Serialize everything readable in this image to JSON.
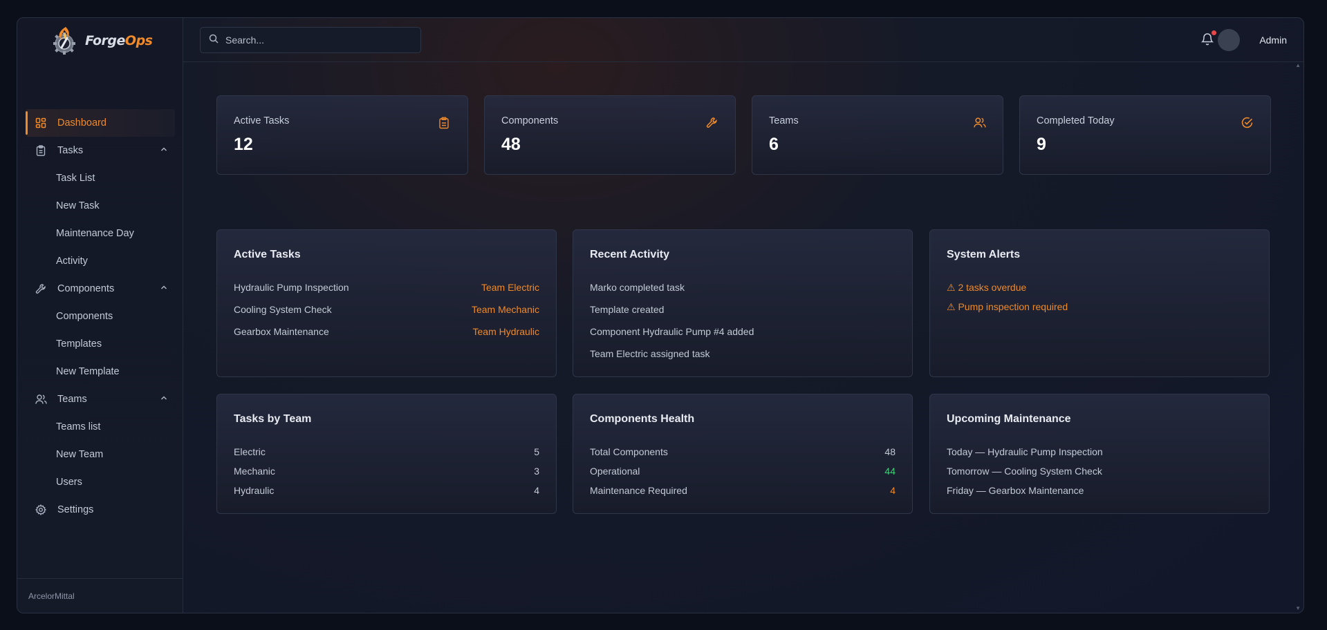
{
  "app": {
    "logo_prefix": "Forge",
    "logo_suffix": "Ops",
    "company": "ArcelorMittal"
  },
  "colors": {
    "accent": "#f08a2a",
    "success": "#44d07a",
    "alert_dot": "#e8474a"
  },
  "search": {
    "placeholder": "Search...",
    "value": ""
  },
  "user": {
    "name": "Admin"
  },
  "sidebar": {
    "dashboard": {
      "label": "Dashboard",
      "icon": "dashboard-icon"
    },
    "tasks": {
      "label": "Tasks",
      "icon": "clipboard-icon",
      "sub": [
        "Task List",
        "New Task",
        "Maintenance Day",
        "Activity"
      ]
    },
    "components": {
      "label": "Components",
      "icon": "wrench-icon",
      "sub": [
        "Components",
        "Templates",
        "New Template"
      ]
    },
    "teams": {
      "label": "Teams",
      "icon": "users-icon",
      "sub": [
        "Teams list",
        "New Team",
        "Users"
      ]
    },
    "settings": {
      "label": "Settings",
      "icon": "gear-icon"
    }
  },
  "stats": [
    {
      "label": "Active Tasks",
      "value": "12",
      "icon": "clipboard-icon"
    },
    {
      "label": "Components",
      "value": "48",
      "icon": "wrench-icon"
    },
    {
      "label": "Teams",
      "value": "6",
      "icon": "users-icon"
    },
    {
      "label": "Completed Today",
      "value": "9",
      "icon": "check-circle-icon"
    }
  ],
  "active_tasks": {
    "title": "Active Tasks",
    "rows": [
      {
        "name": "Hydraulic Pump Inspection",
        "team": "Team Electric"
      },
      {
        "name": "Cooling System Check",
        "team": "Team Mechanic"
      },
      {
        "name": "Gearbox Maintenance",
        "team": "Team Hydraulic"
      }
    ]
  },
  "recent_activity": {
    "title": "Recent Activity",
    "items": [
      "Marko completed task",
      "Template created",
      "Component Hydraulic Pump #4 added",
      "Team Electric assigned task"
    ]
  },
  "system_alerts": {
    "title": "System Alerts",
    "items": [
      "⚠ 2 tasks overdue",
      "⚠ Pump inspection required"
    ]
  },
  "tasks_by_team": {
    "title": "Tasks by Team",
    "rows": [
      {
        "team": "Electric",
        "count": "5"
      },
      {
        "team": "Mechanic",
        "count": "3"
      },
      {
        "team": "Hydraulic",
        "count": "4"
      }
    ]
  },
  "components_health": {
    "title": "Components Health",
    "rows": [
      {
        "label": "Total Components",
        "value": "48"
      },
      {
        "label": "Operational",
        "value": "44"
      },
      {
        "label": "Maintenance Required",
        "value": "4"
      }
    ]
  },
  "upcoming_maintenance": {
    "title": "Upcoming Maintenance",
    "items": [
      "Today — Hydraulic Pump Inspection",
      "Tomorrow — Cooling System Check",
      "Friday — Gearbox Maintenance"
    ]
  }
}
